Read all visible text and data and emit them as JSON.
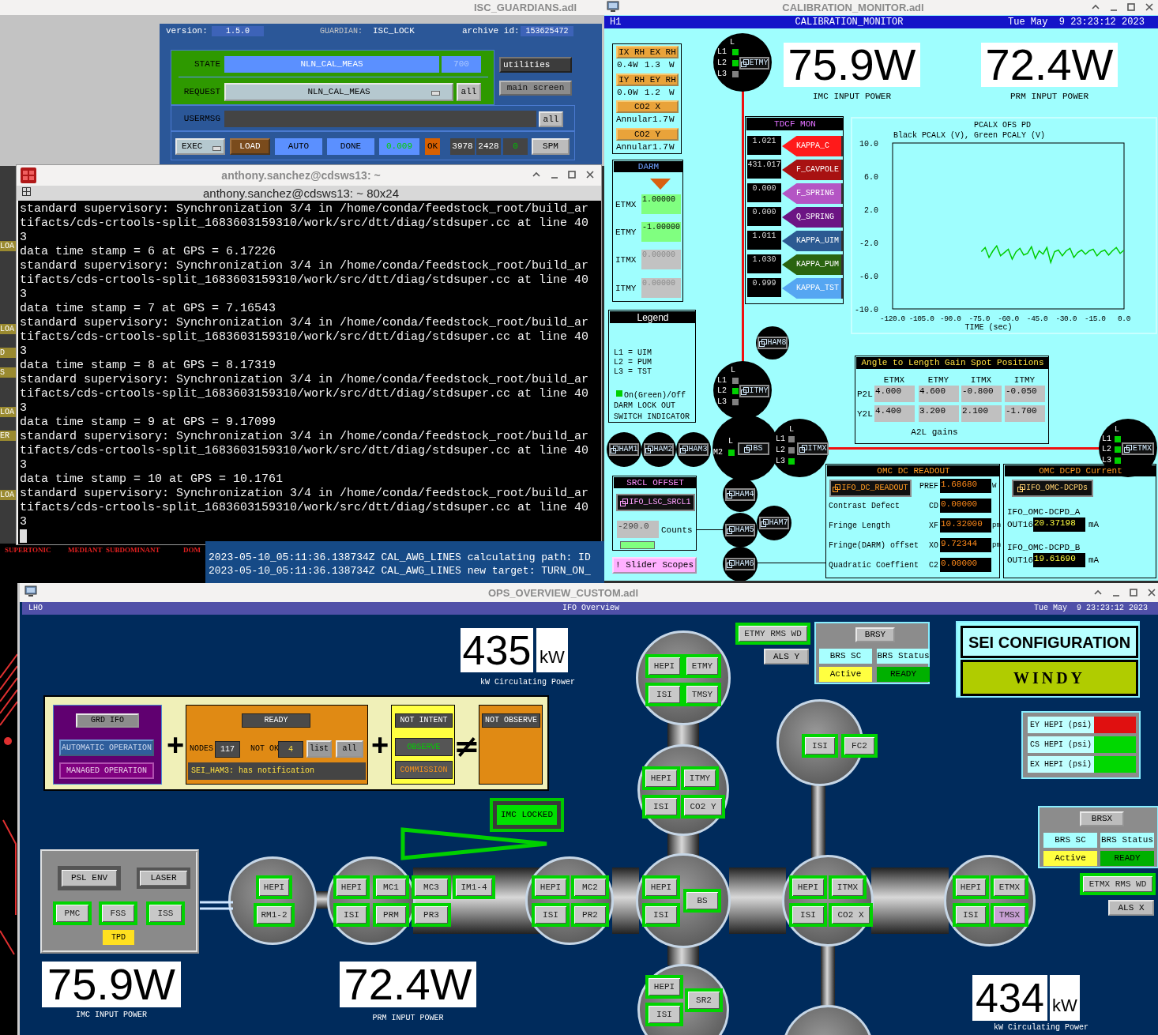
{
  "guardian_window": {
    "title": "ISC_GUARDIANS.adl",
    "header": {
      "version_label": "version:",
      "version": "1.5.0",
      "guardian_label": "GUARDIAN:",
      "guardian": "ISC_LOCK",
      "archive_label": "archive id:",
      "archive_id": "153625472"
    },
    "state": {
      "label": "STATE",
      "value": "NLN_CAL_MEAS",
      "index": "700"
    },
    "request": {
      "label": "REQUEST",
      "value": "NLN_CAL_MEAS",
      "all_button": "all"
    },
    "side_buttons": [
      "utilities",
      "main screen"
    ],
    "usermsg": {
      "label": "USERMSG",
      "all_button": "all"
    },
    "status_row": {
      "mode": "EXEC",
      "load": "LOAD",
      "auto": "AUTO",
      "done": "DONE",
      "timer": "0.009",
      "ok": "OK",
      "counters": [
        "3978",
        "2428",
        "0"
      ],
      "spm": "SPM"
    }
  },
  "background_window": {
    "edge_fragments": [
      "LOA",
      "LOA",
      "D",
      "S",
      "LOA",
      "ER",
      "LOA"
    ],
    "scale_degrees": [
      "SUPERTONIC",
      "MEDIANT",
      "SUBDOMINANT",
      "DOM"
    ]
  },
  "terminal_window": {
    "title": "anthony.sanchez@cdsws13: ~",
    "subtitle": "anthony.sanchez@cdsws13: ~ 80x24",
    "lines": [
      "standard supervisory: Synchronization 3/4 in /home/conda/feedstock_root/build_ar",
      "tifacts/cds-crtools-split_1683603159310/work/src/dtt/diag/stdsuper.cc at line 40",
      "3",
      "data time stamp = 6 at GPS = 6.17226",
      "standard supervisory: Synchronization 3/4 in /home/conda/feedstock_root/build_ar",
      "tifacts/cds-crtools-split_1683603159310/work/src/dtt/diag/stdsuper.cc at line 40",
      "3",
      "data time stamp = 7 at GPS = 7.16543",
      "standard supervisory: Synchronization 3/4 in /home/conda/feedstock_root/build_ar",
      "tifacts/cds-crtools-split_1683603159310/work/src/dtt/diag/stdsuper.cc at line 40",
      "3",
      "data time stamp = 8 at GPS = 8.17319",
      "standard supervisory: Synchronization 3/4 in /home/conda/feedstock_root/build_ar",
      "tifacts/cds-crtools-split_1683603159310/work/src/dtt/diag/stdsuper.cc at line 40",
      "3",
      "data time stamp = 9 at GPS = 9.17099",
      "standard supervisory: Synchronization 3/4 in /home/conda/feedstock_root/build_ar",
      "tifacts/cds-crtools-split_1683603159310/work/src/dtt/diag/stdsuper.cc at line 40",
      "3",
      "data time stamp = 10 at GPS = 10.1761",
      "standard supervisory: Synchronization 3/4 in /home/conda/feedstock_root/build_ar",
      "tifacts/cds-crtools-split_1683603159310/work/src/dtt/diag/stdsuper.cc at line 40",
      "3"
    ]
  },
  "log_window": {
    "lines": [
      "2023-05-10_05:11:36.138734Z CAL_AWG_LINES calculating path: ID",
      "2023-05-10_05:11:36.138734Z CAL_AWG_LINES new target: TURN_ON_"
    ]
  },
  "calibration_window": {
    "title": "CALIBRATION_MONITOR.adl",
    "header": {
      "site": "H1",
      "name": "CALIBRATION_MONITOR",
      "datetime": "Tue May  9 23:23:12 2023"
    },
    "heating": [
      {
        "button": "IX RH EX RH",
        "readings": [
          "0.4",
          "W",
          "1.3",
          "W"
        ]
      },
      {
        "button": "IY RH EY RH",
        "readings": [
          "0.0",
          "W",
          "1.2",
          "W"
        ]
      },
      {
        "button": "CO2 X",
        "readings": [
          "Annular",
          "1.7",
          "W"
        ]
      },
      {
        "button": "CO2 Y",
        "readings": [
          "Annular",
          "1.7",
          "W"
        ]
      }
    ],
    "power_readouts": [
      {
        "value": "75.9W",
        "label": "IMC INPUT POWER"
      },
      {
        "value": "72.4W",
        "label": "PRM INPUT POWER"
      }
    ],
    "darm": {
      "title": "DARM",
      "rows": [
        {
          "label": "ETMX",
          "value": "1.00000",
          "active": true
        },
        {
          "label": "ETMY",
          "value": "-1.00000",
          "active": true
        },
        {
          "label": "ITMX",
          "value": "0.00000",
          "active": false
        },
        {
          "label": "ITMY",
          "value": "0.00000",
          "active": false
        }
      ]
    },
    "tdcf": {
      "title": "TDCF MON",
      "rows": [
        {
          "value": "1.021",
          "label": "KAPPA_C",
          "color": "#ff1a1a"
        },
        {
          "value": "431.017",
          "label": "F_CAVPOLE",
          "color": "#a81212"
        },
        {
          "value": "0.000",
          "label": "F_SPRING",
          "color": "#b455c4"
        },
        {
          "value": "0.000",
          "label": "Q_SPRING",
          "color": "#6c1484"
        },
        {
          "value": "1.011",
          "label": "KAPPA_UIM",
          "color": "#2c5a92"
        },
        {
          "value": "1.030",
          "label": "KAPPA_PUM",
          "color": "#2a6410"
        },
        {
          "value": "0.999",
          "label": "KAPPA_TST",
          "color": "#55a6f2"
        }
      ]
    },
    "plot": {
      "legend_text": "Black PCALX (V), Green PCALY (V)",
      "chart_data": {
        "type": "line",
        "title": "PCALX OFS PD",
        "xlabel": "TIME (sec)",
        "xlim": [
          -120,
          0
        ],
        "ylim": [
          -10,
          10
        ],
        "xticks": [
          {
            "value": -120,
            "label": "-120.0"
          },
          {
            "value": -105,
            "label": "-105.0"
          },
          {
            "value": -90,
            "label": "-90.0"
          },
          {
            "value": -75,
            "label": "-75.0"
          },
          {
            "value": -60,
            "label": "-60.0"
          },
          {
            "value": -45,
            "label": "-45.0"
          },
          {
            "value": -30,
            "label": "-30.0"
          },
          {
            "value": -15,
            "label": "-15.0"
          },
          {
            "value": 0,
            "label": "0.0"
          }
        ],
        "yticks": [
          {
            "value": 10,
            "label": "10.0"
          },
          {
            "value": 6,
            "label": "6.0"
          },
          {
            "value": 2,
            "label": "2.0"
          },
          {
            "value": -2,
            "label": "-2.0"
          },
          {
            "value": -6,
            "label": "-6.0"
          },
          {
            "value": -10,
            "label": "-10.0"
          }
        ],
        "x": [
          -74,
          -72,
          -70,
          -68,
          -66,
          -64,
          -62,
          -60,
          -58,
          -56,
          -54,
          -52,
          -50,
          -48,
          -46,
          -44,
          -42,
          -40,
          -38,
          -36,
          -34,
          -32,
          -30,
          -28,
          -26,
          -24,
          -22,
          -20,
          -18,
          -16,
          -14,
          -12,
          -10,
          -8,
          -6,
          -4,
          -2,
          0
        ],
        "series": [
          {
            "color": "#00cc00",
            "values": [
              -3.1,
              -2.6,
              -3.8,
              -3.0,
              -2.4,
              -3.6,
              -3.2,
              -2.8,
              -4.0,
              -3.1,
              -2.7,
              -3.5,
              -3.3,
              -2.5,
              -3.9,
              -3.0,
              -3.4,
              -2.6,
              -4.4,
              -3.1,
              -2.9,
              -3.6,
              -3.0,
              -2.7,
              -3.8,
              -3.2,
              -2.9,
              -3.4,
              -3.0,
              -2.8,
              -3.6,
              -3.1,
              -2.9,
              -3.5,
              -3.0,
              -2.6,
              -3.3,
              -2.9
            ]
          }
        ]
      }
    },
    "legend": {
      "title": "Legend",
      "lines": [
        "L1 = UIM",
        "L2 = PUM",
        "L3 = TST"
      ],
      "indicator_text": "On(Green)/Off",
      "notes": [
        "DARM LOCK OUT",
        "SWITCH INDICATOR"
      ]
    },
    "optics": [
      {
        "button": "ETMY",
        "stage_label": "L",
        "stages": [
          {
            "label": "L1",
            "on": true
          },
          {
            "label": "L2",
            "on": true
          },
          {
            "label": "L3",
            "on": false
          }
        ]
      },
      {
        "button": "ITMY",
        "stage_label": "L",
        "stages": [
          {
            "label": "L1",
            "on": false
          },
          {
            "label": "L2",
            "on": true
          },
          {
            "label": "L3",
            "on": false
          }
        ]
      },
      {
        "button": "BS",
        "stage_label": "L",
        "stages": [
          {
            "label": "M2",
            "on": true
          }
        ]
      },
      {
        "button": "ITMX",
        "stage_label": "L",
        "stages": [
          {
            "label": "L1",
            "on": false
          },
          {
            "label": "L2",
            "on": false
          },
          {
            "label": "L3",
            "on": true
          }
        ]
      },
      {
        "button": "ETMX",
        "stage_label": "L",
        "stages": [
          {
            "label": "L1",
            "on": true
          },
          {
            "label": "L2",
            "on": true
          },
          {
            "label": "L3",
            "on": true
          }
        ]
      }
    ],
    "hams": [
      "HAM8",
      "HAM1",
      "HAM2",
      "HAM3",
      "HAM4",
      "HAM7",
      "HAM5",
      "HAM6"
    ],
    "a2l": {
      "title": "Angle to Length Gain Spot Positions",
      "columns": [
        "ETMX",
        "ETMY",
        "ITMX",
        "ITMY"
      ],
      "rows": [
        {
          "label": "P2L",
          "values": [
            "4.000",
            "4.600",
            "-0.800",
            "-0.050"
          ]
        },
        {
          "label": "Y2L",
          "values": [
            "4.400",
            "3.200",
            "2.100",
            "-1.700"
          ]
        }
      ],
      "footer": "A2L gains"
    },
    "srcl": {
      "title": "SRCL OFFSET",
      "button": "IFO_LSC_SRCL1",
      "value": "-290.0",
      "unit": "Counts"
    },
    "slider_scopes": "! Slider Scopes",
    "omc_dc": {
      "title": "OMC DC READOUT",
      "button": "IFO_DC_READOUT",
      "rows": [
        {
          "code": "PREF",
          "value": "1.68680",
          "unit": "W"
        },
        {
          "label": "Contrast Defect",
          "code": "CD",
          "value": "0.00000"
        },
        {
          "label": "Fringe Length",
          "code": "XF",
          "value": "10.32000",
          "unit": "pm"
        },
        {
          "label": "Fringe(DARM) offset",
          "code": "XO",
          "value": "9.72344",
          "unit": "pm"
        },
        {
          "label": "Quadratic Coeffient",
          "code": "C2",
          "value": "0.00000"
        }
      ]
    },
    "omc_dcpd": {
      "title": "OMC DCPD Current",
      "button": "IFO_OMC-DCPDs",
      "channels": [
        {
          "name": "IFO_OMC-DCPD_A",
          "field": "OUT16",
          "value": "20.37198",
          "unit": "mA"
        },
        {
          "name": "IFO_OMC-DCPD_B",
          "field": "OUT16",
          "value": "19.61690",
          "unit": "mA"
        }
      ]
    }
  },
  "ops_window": {
    "title": "OPS_OVERVIEW_CUSTOM.adl",
    "header": {
      "site": "LHO",
      "name": "IFO Overview",
      "datetime": "Tue May  9 23:23:12 2023"
    },
    "circulating_power": [
      {
        "value": "435",
        "unit": "kW",
        "label": "kW Circulating Power"
      },
      {
        "value": "434",
        "unit": "kW",
        "label": "kW Circulating Power"
      }
    ],
    "input_power": [
      {
        "value": "75.9W",
        "label": "IMC INPUT POWER"
      },
      {
        "value": "72.4W",
        "label": "PRM INPUT POWER"
      }
    ],
    "guardian_summary": {
      "grd_button": "GRD IFO",
      "modes": [
        {
          "label": "AUTOMATIC OPERATION",
          "selected": true
        },
        {
          "label": "MANAGED OPERATION",
          "selected": false
        }
      ],
      "plus_signs": [
        "+",
        "+"
      ],
      "ready": {
        "state": "READY",
        "nodes_label": "NODES",
        "nodes": "117",
        "not_ok_label": "NOT OK",
        "not_ok": "4",
        "buttons": [
          "list",
          "all"
        ],
        "message": "SEI_HAM3: has notification"
      },
      "intent": {
        "state": "NOT INTENT",
        "buttons": [
          "OBSERVE",
          "COMMISSION"
        ]
      },
      "not_equal": "≠",
      "observe": {
        "state": "NOT OBSERVE"
      }
    },
    "imc_locked": "IMC LOCKED",
    "psl": {
      "buttons": [
        "PSL ENV",
        "LASER"
      ],
      "loops": [
        "PMC",
        "FSS",
        "ISS"
      ],
      "tpd": "TPD"
    },
    "chamber_buttons": [
      {
        "label": "HEPI",
        "flagged": false
      },
      {
        "label": "RM1-2",
        "flagged": false
      },
      {
        "label": "HEPI",
        "flagged": false
      },
      {
        "label": "MC1",
        "flagged": false
      },
      {
        "label": "ISI",
        "flagged": false
      },
      {
        "label": "PRM",
        "flagged": false
      },
      {
        "label": "MC3",
        "flagged": false
      },
      {
        "label": "IM1-4",
        "flagged": false
      },
      {
        "label": "PR3",
        "flagged": false
      },
      {
        "label": "HEPI",
        "flagged": false
      },
      {
        "label": "MC2",
        "flagged": false
      },
      {
        "label": "ISI",
        "flagged": false
      },
      {
        "label": "PR2",
        "flagged": false
      },
      {
        "label": "HEPI",
        "flagged": false
      },
      {
        "label": "ISI",
        "flagged": false
      },
      {
        "label": "BS",
        "flagged": false
      },
      {
        "label": "HEPI",
        "flagged": false
      },
      {
        "label": "ETMY",
        "flagged": false
      },
      {
        "label": "ISI",
        "flagged": false
      },
      {
        "label": "TMSY",
        "flagged": false
      },
      {
        "label": "HEPI",
        "flagged": false
      },
      {
        "label": "ITMY",
        "flagged": false
      },
      {
        "label": "ISI",
        "flagged": false
      },
      {
        "label": "CO2 Y",
        "flagged": false
      },
      {
        "label": "ISI",
        "flagged": false
      },
      {
        "label": "FC2",
        "flagged": false
      },
      {
        "label": "HEPI",
        "flagged": false
      },
      {
        "label": "ITMX",
        "flagged": false
      },
      {
        "label": "ISI",
        "flagged": false
      },
      {
        "label": "CO2 X",
        "flagged": false
      },
      {
        "label": "HEPI",
        "flagged": false
      },
      {
        "label": "ETMX",
        "flagged": false
      },
      {
        "label": "ISI",
        "flagged": false
      },
      {
        "label": "TMSX",
        "flagged": true
      },
      {
        "label": "HEPI",
        "flagged": false
      },
      {
        "label": "SR2",
        "flagged": false
      },
      {
        "label": "ISI",
        "flagged": false
      }
    ],
    "etmy_watchdog": "ETMY RMS WD",
    "als_y": "ALS Y",
    "brsy": {
      "button": "BRSY",
      "labels": [
        "BRS SC",
        "BRS Status"
      ],
      "values": [
        "Active",
        "READY"
      ]
    },
    "sei_config": {
      "title": "SEI CONFIGURATION",
      "state": "WINDY"
    },
    "hepi_pressure": [
      {
        "label": "EY HEPI (psi)",
        "color": "#e01010"
      },
      {
        "label": "CS HEPI (psi)",
        "color": "#00d800"
      },
      {
        "label": "EX HEPI (psi)",
        "color": "#00d800"
      }
    ],
    "brsx": {
      "button": "BRSX",
      "labels": [
        "BRS SC",
        "BRS Status"
      ],
      "values": [
        "Active",
        "READY"
      ]
    },
    "etmx_watchdog": "ETMX RMS WD",
    "als_x": "ALS X"
  }
}
